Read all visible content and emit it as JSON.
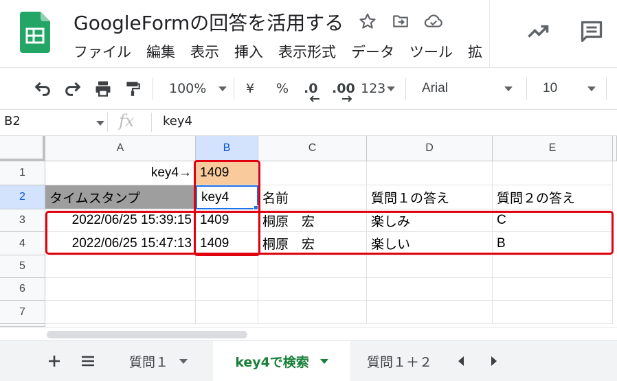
{
  "app": {
    "doc_title": "GoogleFormの回答を活用する",
    "menu": [
      "ファイル",
      "編集",
      "表示",
      "挿入",
      "表示形式",
      "データ",
      "ツール",
      "拡"
    ]
  },
  "toolbar": {
    "zoom": "100%",
    "currency": "¥",
    "percent": "%",
    "decrease_decimal": ".0",
    "increase_decimal": ".00",
    "number_format": "123",
    "font": "Arial",
    "font_size": "10"
  },
  "formula_bar": {
    "name_box": "B2",
    "fx": "fx",
    "value": "key4"
  },
  "grid": {
    "columns": [
      "A",
      "B",
      "C",
      "D",
      "E"
    ],
    "rows": [
      "1",
      "2",
      "3",
      "4",
      "5",
      "6",
      "7"
    ],
    "cells": {
      "a1": "key4→",
      "b1": "1409",
      "a2": "タイムスタンプ",
      "b2": "key4",
      "c2": "名前",
      "d2": "質問１の答え",
      "e2": "質問２の答え",
      "a3": "2022/06/25 15:39:15",
      "b3": "1409",
      "c3": "桐原　宏",
      "d3": "楽しみ",
      "e3": "C",
      "a4": "2022/06/25 15:47:13",
      "b4": "1409",
      "c4": "桐原　宏",
      "d4": "楽しい",
      "e4": "B"
    }
  },
  "sheets": {
    "tabs": [
      "質問１",
      "key4で検索",
      "質問１＋２"
    ],
    "active": "key4で検索"
  },
  "colors": {
    "highlight": "#f9cb9c",
    "header_fill": "#9e9e9e",
    "annotation": "#e0000f",
    "active_tab": "#188038",
    "selection": "#1a73e8"
  },
  "icons": [
    "sheets-logo-icon",
    "star-icon",
    "move-folder-icon",
    "cloud-saved-icon",
    "trend-icon",
    "comment-icon",
    "undo-icon",
    "redo-icon",
    "print-icon",
    "paint-format-icon",
    "add-sheet-icon",
    "all-sheets-icon",
    "scroll-left-icon",
    "scroll-right-icon"
  ]
}
